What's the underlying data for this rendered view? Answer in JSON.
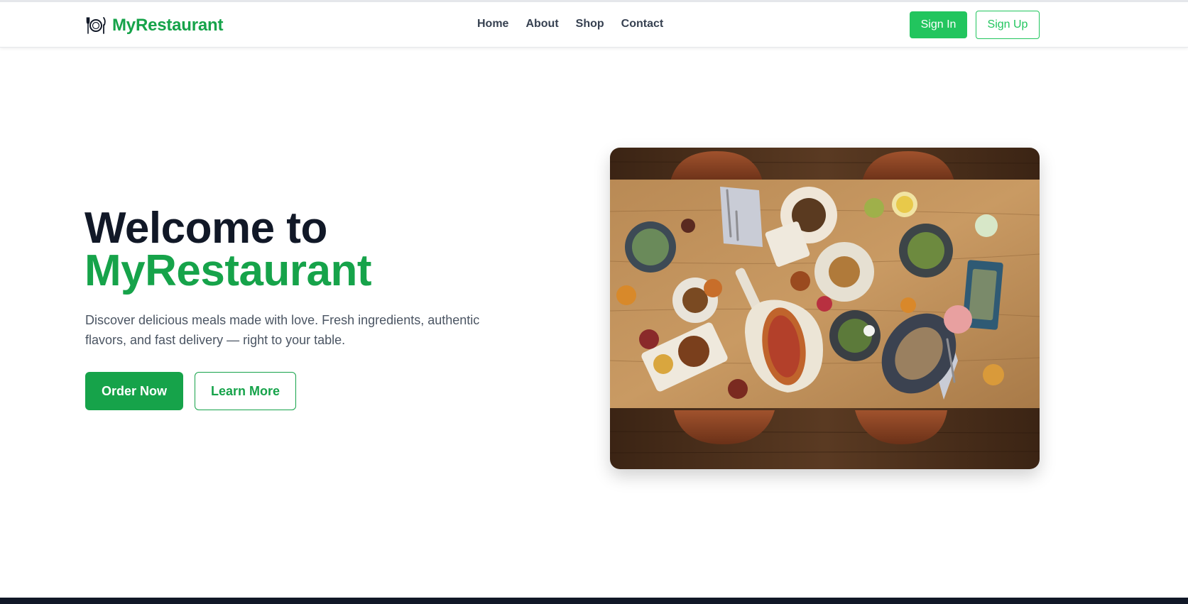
{
  "brand": {
    "name": "MyRestaurant",
    "icon": "plate-cutlery-icon",
    "color": "#16a34a"
  },
  "nav": {
    "links": [
      "Home",
      "About",
      "Shop",
      "Contact"
    ]
  },
  "auth": {
    "signin_label": "Sign In",
    "signup_label": "Sign Up"
  },
  "hero": {
    "title_line1": "Welcome to",
    "title_line2": "MyRestaurant",
    "description": "Discover delicious meals made with love. Fresh ingredients, authentic flavors, and fast delivery — right to your table.",
    "primary_cta": "Order Now",
    "secondary_cta": "Learn More",
    "image": "restaurant-table-food-photo"
  },
  "colors": {
    "accent": "#16a34a",
    "accent_light": "#22c55e",
    "heading": "#111827",
    "body_text": "#4b5563",
    "footer": "#111827"
  }
}
